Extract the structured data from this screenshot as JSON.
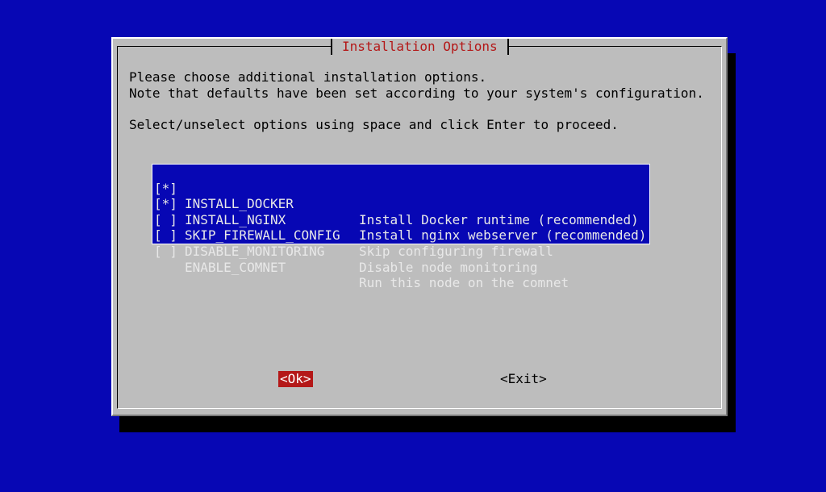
{
  "dialog": {
    "title": "Installation Options",
    "lines": [
      "Please choose additional installation options.",
      "Note that defaults have been set according to your system's configuration.",
      "",
      "Select/unselect options using space and click Enter to proceed."
    ]
  },
  "options": [
    {
      "check": "[*]",
      "tag": "INSTALL_DOCKER",
      "description": "Install Docker runtime (recommended)"
    },
    {
      "check": "[*]",
      "tag": "INSTALL_NGINX",
      "description": "Install nginx webserver (recommended)"
    },
    {
      "check": "[ ]",
      "tag": "SKIP_FIREWALL_CONFIG",
      "description": "Skip configuring firewall"
    },
    {
      "check": "[ ]",
      "tag": "DISABLE_MONITORING",
      "description": "Disable node monitoring"
    },
    {
      "check": "[ ]",
      "tag": "ENABLE_COMNET",
      "description": "Run this node on the comnet"
    }
  ],
  "buttons": {
    "ok": "<Ok>",
    "exit": "<Exit>"
  },
  "colors": {
    "background": "#0707b4",
    "dialog": "#bdbdbd",
    "title": "#b41818",
    "selected_button": "#b41818"
  }
}
